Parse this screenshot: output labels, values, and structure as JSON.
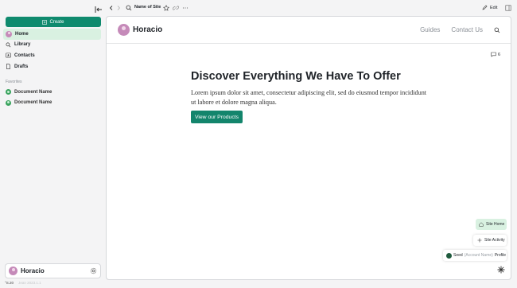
{
  "sidebar": {
    "create_label": "Create",
    "items": [
      {
        "label": "Home",
        "active": true
      },
      {
        "label": "Library"
      },
      {
        "label": "Contacts"
      },
      {
        "label": "Drafts"
      }
    ],
    "favorites_title": "Favorites",
    "favorites": [
      {
        "label": "Document Name"
      },
      {
        "label": "Document Name"
      }
    ],
    "user_name": "Horacio",
    "version": "°S.20",
    "version_faint": "Jean 2023.1.1"
  },
  "topbar": {
    "site_name": "Name of Site",
    "edit_label": "Edit"
  },
  "site": {
    "brand": "Horacio",
    "nav": [
      "Guides",
      "Contact Us"
    ],
    "comment_count": "6",
    "hero_title": "Discover Everything We Have To Offer",
    "hero_text": "Lorem ipsum dolor sit amet, consectetur adipiscing elit, sed do eiusmod tempor incididunt ut labore et dolore magna aliqua.",
    "hero_button": "View our Products"
  },
  "floating": {
    "site_home": "Site Home",
    "site_activity": "Site Activity",
    "profile_prefix": "Seed",
    "profile_muted": "(Account Name)",
    "profile_suffix": "Profile"
  },
  "colors": {
    "accent": "#0f8a6e",
    "active_bg": "#d9f1e1"
  }
}
